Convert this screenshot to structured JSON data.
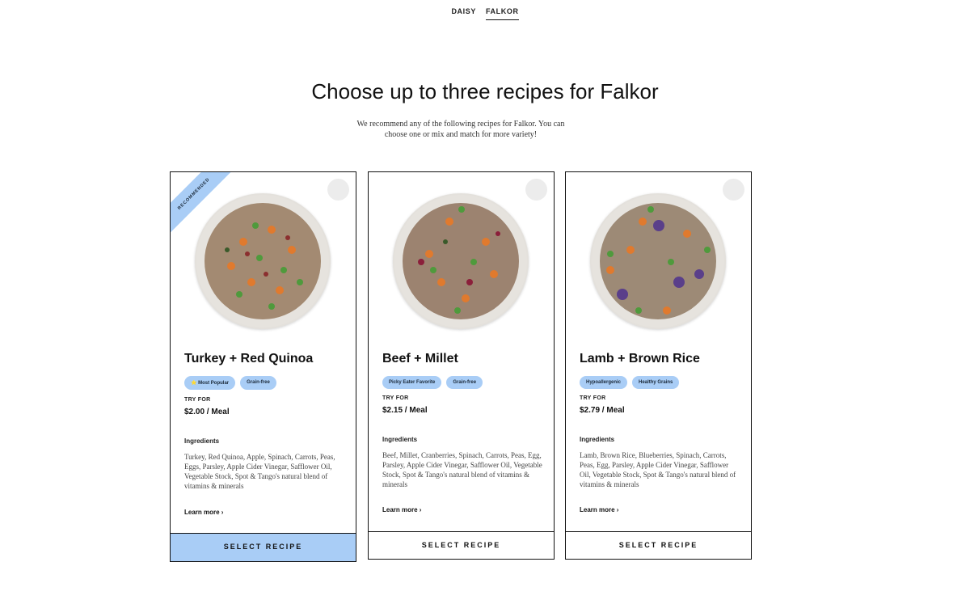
{
  "tabs": [
    {
      "label": "DAISY",
      "active": false
    },
    {
      "label": "FALKOR",
      "active": true
    }
  ],
  "title": "Choose up to three recipes for Falkor",
  "subtitle": "We recommend any of the following recipes for Falkor. You can choose one or mix and match for more variety!",
  "colors": {
    "accent": "#a9cdf6",
    "border": "#111111"
  },
  "recipes": [
    {
      "ribbon": "RECOMMENDED",
      "name": "Turkey + Red Quinoa",
      "badges": [
        "⭐ Most Popular",
        "Grain-free"
      ],
      "try_for": "TRY FOR",
      "price": "$2.00 / Meal",
      "ingredients_title": "Ingredients",
      "ingredients": "Turkey, Red Quinoa, Apple, Spinach, Carrots, Peas, Eggs, Parsley, Apple Cider Vinegar, Safflower Oil, Vegetable Stock, Spot & Tango's natural blend of vitamins & minerals",
      "learn_more": "Learn more ›",
      "select_label": "SELECT RECIPE",
      "selected": true
    },
    {
      "name": "Beef + Millet",
      "badges": [
        "Picky Eater Favorite",
        "Grain-free"
      ],
      "try_for": "TRY FOR",
      "price": "$2.15 / Meal",
      "ingredients_title": "Ingredients",
      "ingredients": "Beef, Millet, Cranberries, Spinach, Carrots, Peas, Egg, Parsley, Apple Cider Vinegar, Safflower Oil, Vegetable Stock, Spot & Tango's natural blend of vitamins & minerals",
      "learn_more": "Learn more ›",
      "select_label": "SELECT RECIPE",
      "selected": false
    },
    {
      "name": "Lamb + Brown Rice",
      "badges": [
        "Hypoallergenic",
        "Healthy Grains"
      ],
      "try_for": "TRY FOR",
      "price": "$2.79 / Meal",
      "ingredients_title": "Ingredients",
      "ingredients": "Lamb, Brown Rice, Blueberries, Spinach, Carrots, Peas, Egg, Parsley, Apple Cider Vinegar, Safflower Oil, Vegetable Stock, Spot & Tango's natural blend of vitamins & minerals",
      "learn_more": "Learn more ›",
      "select_label": "SELECT RECIPE",
      "selected": false
    }
  ]
}
